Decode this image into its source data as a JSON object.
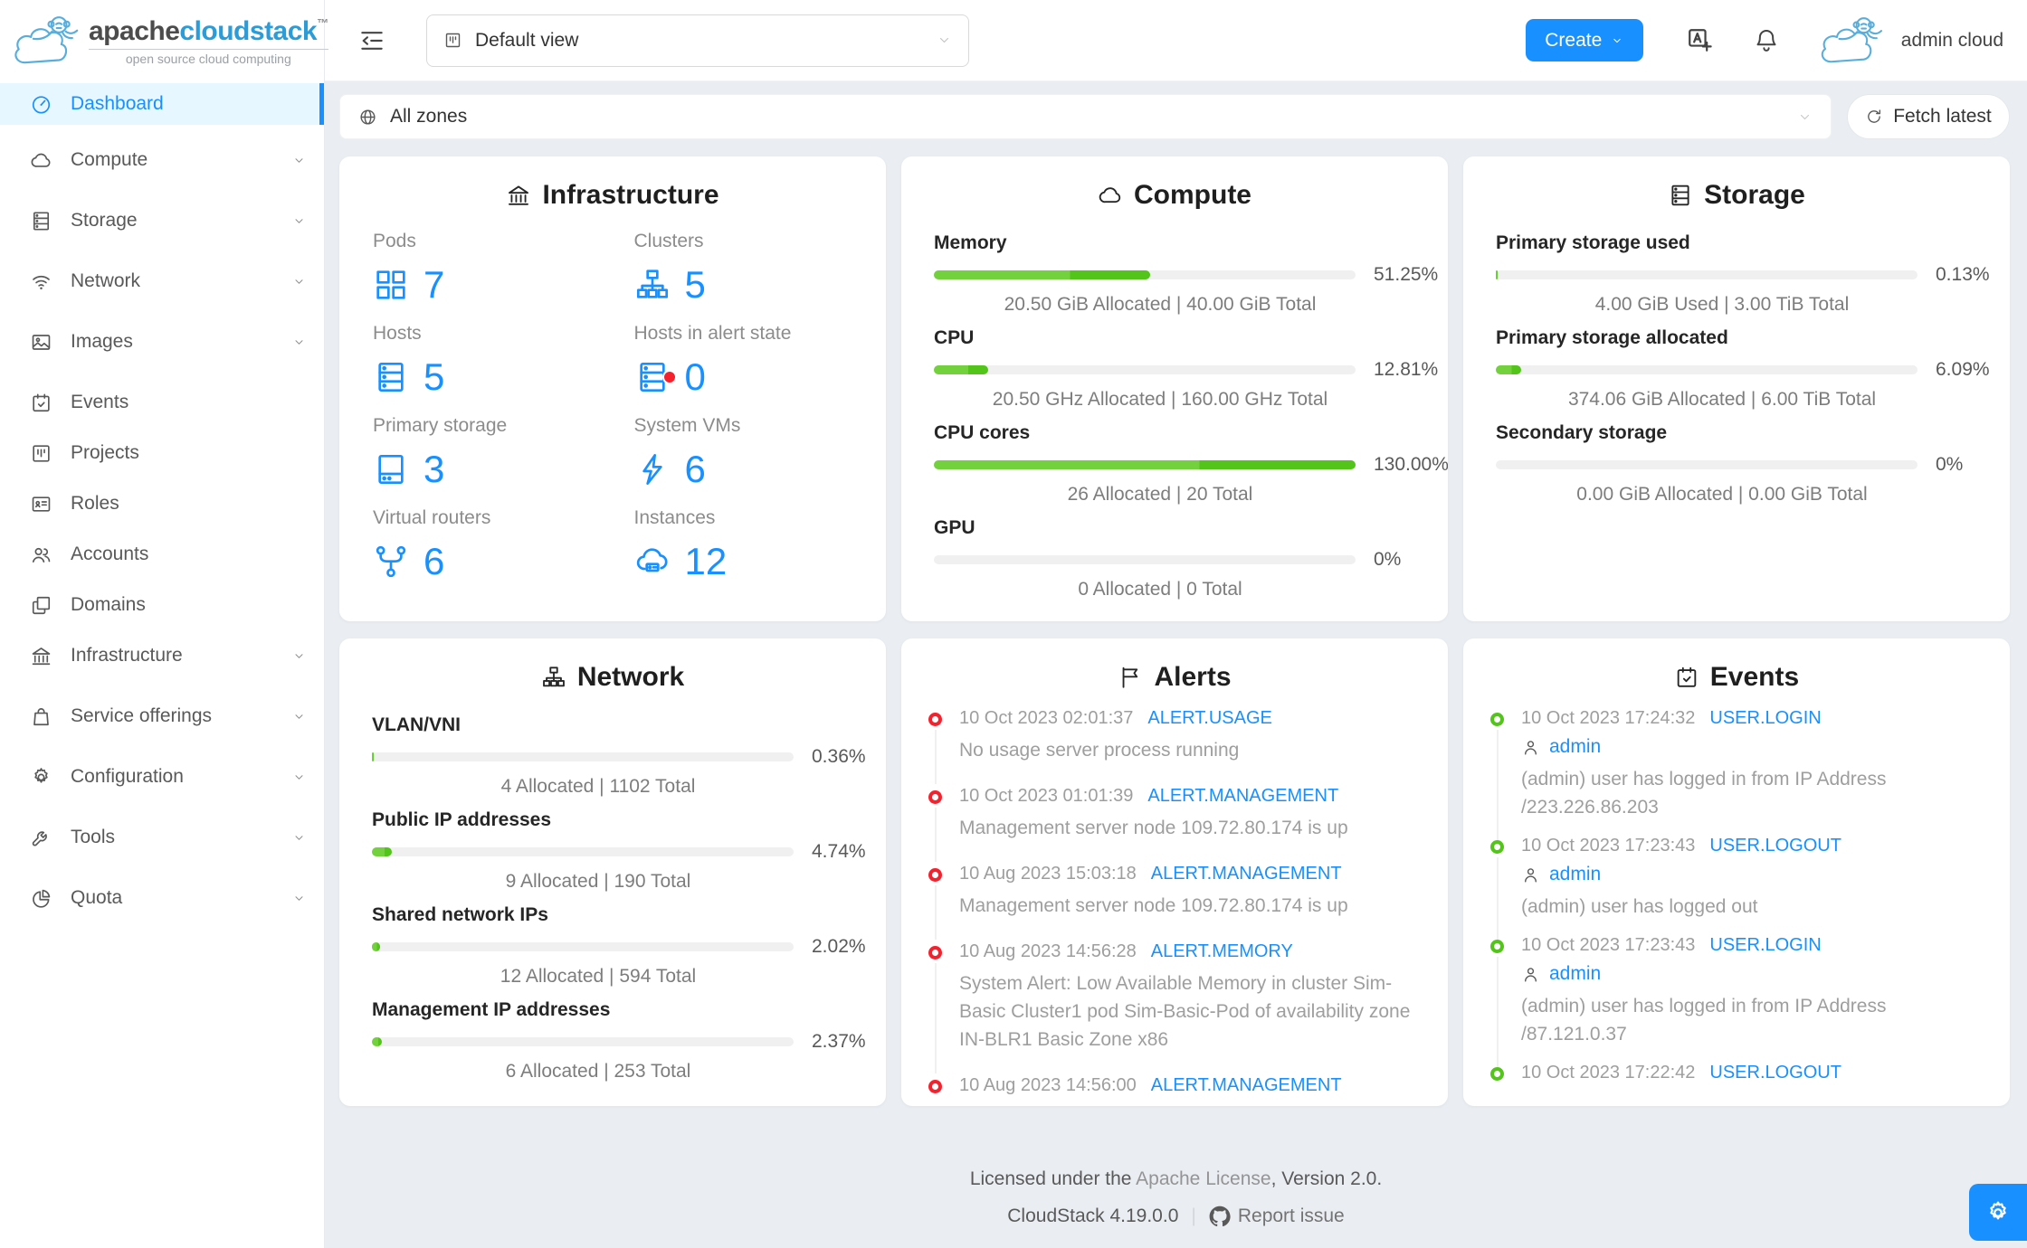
{
  "brand": {
    "name_part1": "apache",
    "name_part2": "cloudstack",
    "trademark": "TM",
    "tagline": "open source cloud computing"
  },
  "topbar": {
    "view_selector_value": "Default view",
    "create_label": "Create",
    "user_name": "admin cloud"
  },
  "zonebar": {
    "zone_selector_value": "All zones",
    "fetch_label": "Fetch latest"
  },
  "sidebar": {
    "items": [
      {
        "label": "Dashboard",
        "active": true,
        "has_children": false
      },
      {
        "label": "Compute",
        "active": false,
        "has_children": true
      },
      {
        "label": "Storage",
        "active": false,
        "has_children": true
      },
      {
        "label": "Network",
        "active": false,
        "has_children": true
      },
      {
        "label": "Images",
        "active": false,
        "has_children": true
      },
      {
        "label": "Events",
        "active": false,
        "has_children": false
      },
      {
        "label": "Projects",
        "active": false,
        "has_children": false
      },
      {
        "label": "Roles",
        "active": false,
        "has_children": false
      },
      {
        "label": "Accounts",
        "active": false,
        "has_children": false
      },
      {
        "label": "Domains",
        "active": false,
        "has_children": false
      },
      {
        "label": "Infrastructure",
        "active": false,
        "has_children": true
      },
      {
        "label": "Service offerings",
        "active": false,
        "has_children": true
      },
      {
        "label": "Configuration",
        "active": false,
        "has_children": true
      },
      {
        "label": "Tools",
        "active": false,
        "has_children": true
      },
      {
        "label": "Quota",
        "active": false,
        "has_children": true
      }
    ]
  },
  "cards": {
    "infrastructure": {
      "title": "Infrastructure",
      "stats": [
        {
          "label": "Pods",
          "value": "7",
          "icon": "appstore-icon"
        },
        {
          "label": "Clusters",
          "value": "5",
          "icon": "cluster-icon"
        },
        {
          "label": "Hosts",
          "value": "5",
          "icon": "server-icon"
        },
        {
          "label": "Hosts in alert state",
          "value": "0",
          "icon": "server-alert-icon"
        },
        {
          "label": "Primary storage",
          "value": "3",
          "icon": "hdd-icon"
        },
        {
          "label": "System VMs",
          "value": "6",
          "icon": "thunderbolt-icon"
        },
        {
          "label": "Virtual routers",
          "value": "6",
          "icon": "fork-icon"
        },
        {
          "label": "Instances",
          "value": "12",
          "icon": "cloud-server-icon"
        }
      ]
    },
    "compute": {
      "title": "Compute",
      "rows": [
        {
          "label": "Memory",
          "percent_label": "51.25%",
          "fill": 51.25,
          "caption": "20.50 GiB Allocated | 40.00 GiB Total"
        },
        {
          "label": "CPU",
          "percent_label": "12.81%",
          "fill": 12.81,
          "caption": "20.50 GHz Allocated | 160.00 GHz Total"
        },
        {
          "label": "CPU cores",
          "percent_label": "130.00%",
          "fill": 100,
          "caption": "26 Allocated | 20 Total"
        },
        {
          "label": "GPU",
          "percent_label": "0%",
          "fill": 0,
          "caption": "0 Allocated | 0 Total"
        }
      ]
    },
    "storage": {
      "title": "Storage",
      "rows": [
        {
          "label": "Primary storage used",
          "percent_label": "0.13%",
          "fill": 0.4,
          "caption": "4.00 GiB Used | 3.00 TiB Total"
        },
        {
          "label": "Primary storage allocated",
          "percent_label": "6.09%",
          "fill": 6.09,
          "caption": "374.06 GiB Allocated | 6.00 TiB Total"
        },
        {
          "label": "Secondary storage",
          "percent_label": "0%",
          "fill": 0,
          "caption": "0.00 GiB Allocated | 0.00 GiB Total"
        }
      ]
    },
    "network": {
      "title": "Network",
      "rows": [
        {
          "label": "VLAN/VNI",
          "percent_label": "0.36%",
          "fill": 0.5,
          "caption": "4 Allocated | 1102 Total"
        },
        {
          "label": "Public IP addresses",
          "percent_label": "4.74%",
          "fill": 4.74,
          "caption": "9 Allocated | 190 Total"
        },
        {
          "label": "Shared network IPs",
          "percent_label": "2.02%",
          "fill": 2.02,
          "caption": "12 Allocated | 594 Total"
        },
        {
          "label": "Management IP addresses",
          "percent_label": "2.37%",
          "fill": 2.37,
          "caption": "6 Allocated | 253 Total"
        }
      ]
    },
    "alerts": {
      "title": "Alerts",
      "items": [
        {
          "date": "10 Oct 2023 02:01:37",
          "type": "ALERT.USAGE",
          "message": "No usage server process running"
        },
        {
          "date": "10 Oct 2023 01:01:39",
          "type": "ALERT.MANAGEMENT",
          "message": "Management server node 109.72.80.174 is up"
        },
        {
          "date": "10 Aug 2023 15:03:18",
          "type": "ALERT.MANAGEMENT",
          "message": "Management server node 109.72.80.174 is up"
        },
        {
          "date": "10 Aug 2023 14:56:28",
          "type": "ALERT.MEMORY",
          "message": "System Alert: Low Available Memory in cluster Sim-Basic Cluster1 pod Sim-Basic-Pod of availability zone IN-BLR1 Basic Zone x86"
        },
        {
          "date": "10 Aug 2023 14:56:00",
          "type": "ALERT.MANAGEMENT",
          "message": ""
        }
      ]
    },
    "events": {
      "title": "Events",
      "items": [
        {
          "date": "10 Oct 2023 17:24:32",
          "type": "USER.LOGIN",
          "user": "admin",
          "message": "(admin) user has logged in from IP Address /223.226.86.203"
        },
        {
          "date": "10 Oct 2023 17:23:43",
          "type": "USER.LOGOUT",
          "user": "admin",
          "message": "(admin) user has logged out"
        },
        {
          "date": "10 Oct 2023 17:23:43",
          "type": "USER.LOGIN",
          "user": "admin",
          "message": "(admin) user has logged in from IP Address /87.121.0.37"
        },
        {
          "date": "10 Oct 2023 17:22:42",
          "type": "USER.LOGOUT",
          "user": "",
          "message": ""
        }
      ]
    }
  },
  "footer": {
    "license_prefix": "Licensed under the ",
    "license_link": "Apache License",
    "license_suffix": ", Version 2.0.",
    "version": "CloudStack 4.19.0.0",
    "report_issue": "Report issue"
  },
  "colors": {
    "primary": "#1890ff",
    "progress_light": "#73d13d",
    "progress_dark": "#52c41a",
    "alert_red": "#f5222d",
    "event_green": "#52c41a",
    "active_bg": "#e6f7ff"
  }
}
